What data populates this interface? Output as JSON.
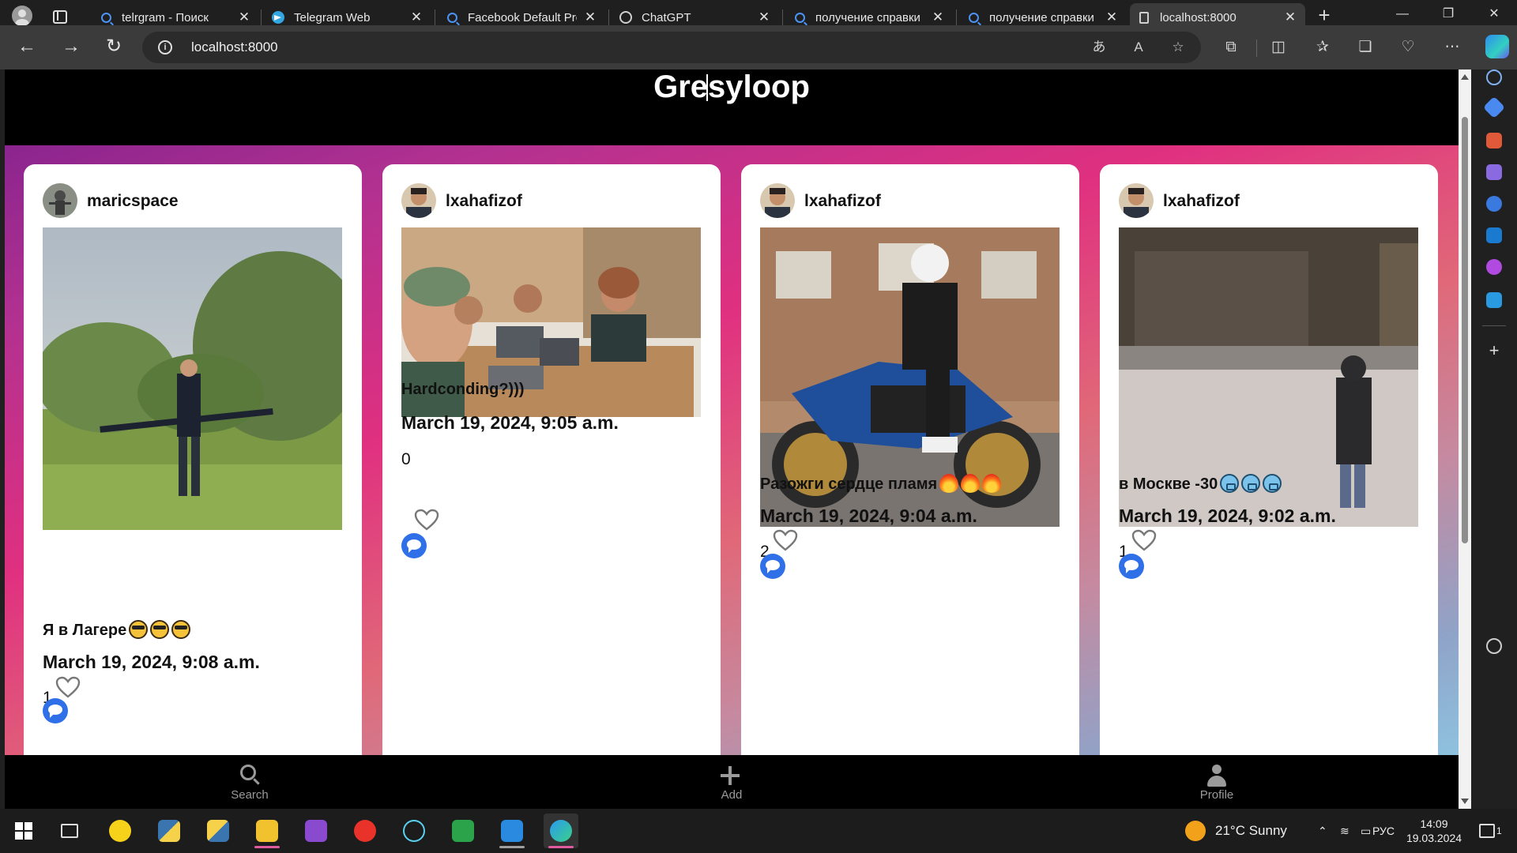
{
  "browser": {
    "tabs": [
      {
        "title": "telrgram - Поиск",
        "icon": "search-icon"
      },
      {
        "title": "Telegram Web",
        "icon": "telegram-icon"
      },
      {
        "title": "Facebook Default Profile",
        "icon": "search-icon"
      },
      {
        "title": "ChatGPT",
        "icon": "chatgpt-icon"
      },
      {
        "title": "получение справки",
        "icon": "search-icon"
      },
      {
        "title": "получение справки",
        "icon": "search-icon"
      },
      {
        "title": "localhost:8000",
        "icon": "page-icon",
        "active": true
      }
    ],
    "url": "localhost:8000",
    "sidebar_badge_color": "#2e8cf0"
  },
  "app": {
    "title": "Gresyloop",
    "posts": [
      {
        "username": "maricspace",
        "caption": "Я в Лагере",
        "caption_emoji": "smiling-face-with-sunglasses",
        "caption_emoji_count": 3,
        "date": "March 19, 2024, 9:08 a.m.",
        "likes": "1"
      },
      {
        "username": "lxahafizof",
        "caption": "Hardconding?)))",
        "caption_emoji": "",
        "caption_emoji_count": 0,
        "date": "March 19, 2024, 9:05 a.m.",
        "likes": "0"
      },
      {
        "username": "lxahafizof",
        "caption": "Разожги сердце пламя",
        "caption_emoji": "fire",
        "caption_emoji_count": 3,
        "date": "March 19, 2024, 9:04 a.m.",
        "likes": "2"
      },
      {
        "username": "lxahafizof",
        "caption": "в Москве -30",
        "caption_emoji": "cold-face",
        "caption_emoji_count": 3,
        "date": "March 19, 2024, 9:02 a.m.",
        "likes": "1"
      }
    ],
    "nav": {
      "search": "Search",
      "add": "Add",
      "profile": "Profile"
    }
  },
  "taskbar": {
    "weather": "21°C  Sunny",
    "lang": "РУС",
    "time": "14:09",
    "date": "19.03.2024",
    "notifications": "1"
  }
}
